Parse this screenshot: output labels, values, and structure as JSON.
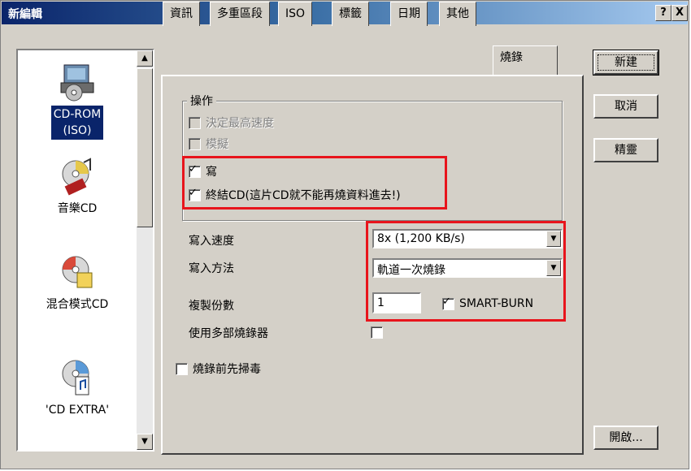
{
  "window": {
    "title": "新編輯",
    "help_btn": "?",
    "close_btn": "X"
  },
  "icons": [
    {
      "label": "CD-ROM\n(ISO)",
      "icon": "cd-rom-icon",
      "selected": true
    },
    {
      "label": "音樂CD",
      "icon": "music-cd-icon",
      "selected": false
    },
    {
      "label": "混合模式CD",
      "icon": "mixed-mode-cd-icon",
      "selected": false
    },
    {
      "label": "'CD EXTRA'",
      "icon": "cd-extra-icon",
      "selected": false
    }
  ],
  "tabs": [
    "資訊",
    "多重區段",
    "ISO",
    "標籤",
    "日期",
    "其他",
    "燒錄"
  ],
  "active_tab": "燒錄",
  "operation": {
    "title": "操作",
    "options": [
      {
        "label": "決定最高速度",
        "checked": false,
        "enabled": false
      },
      {
        "label": "模擬",
        "checked": false,
        "enabled": false
      },
      {
        "label": "寫",
        "checked": true,
        "enabled": true
      },
      {
        "label": "終結CD(這片CD就不能再燒資料進去!)",
        "checked": true,
        "enabled": true
      }
    ]
  },
  "settings": {
    "speed_label": "寫入速度",
    "speed_value": "8x (1,200 KB/s)",
    "method_label": "寫入方法",
    "method_value": "軌道一次燒錄",
    "copies_label": "複製份數",
    "copies_value": "1",
    "smart_burn_label": "SMART-BURN",
    "smart_burn_checked": true,
    "multi_recorder_label": "使用多部燒錄器",
    "multi_recorder_checked": false
  },
  "virus_check": {
    "label": "燒錄前先掃毒",
    "checked": false
  },
  "buttons": {
    "new": "新建",
    "cancel": "取消",
    "wizard": "精靈",
    "open": "開啟..."
  },
  "colors": {
    "highlight": "#e8141c",
    "selection": "#0a246a",
    "face": "#d4d0c8"
  },
  "checkmark": "✓"
}
